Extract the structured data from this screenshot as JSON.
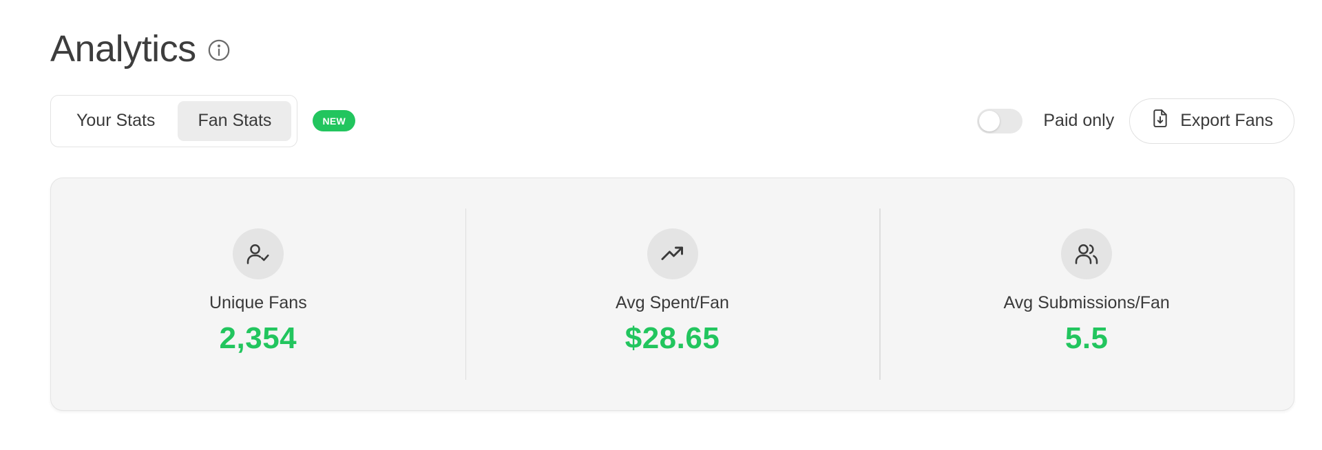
{
  "header": {
    "title": "Analytics",
    "info_icon": "info-circle-icon"
  },
  "tabs": [
    {
      "label": "Your Stats",
      "active": false
    },
    {
      "label": "Fan Stats",
      "active": true
    }
  ],
  "badge": {
    "label": "NEW",
    "color": "#22c55e"
  },
  "filter": {
    "label": "Paid only",
    "enabled": false
  },
  "export": {
    "label": "Export Fans",
    "icon": "file-download-icon"
  },
  "stats": [
    {
      "label": "Unique Fans",
      "value": "2,354",
      "icon": "user-check-icon"
    },
    {
      "label": "Avg Spent/Fan",
      "value": "$28.65",
      "icon": "trending-up-icon"
    },
    {
      "label": "Avg Submissions/Fan",
      "value": "5.5",
      "icon": "users-icon"
    }
  ],
  "colors": {
    "accent": "#22c55e",
    "card_background": "#f5f5f5",
    "text": "#3a3a3a"
  }
}
